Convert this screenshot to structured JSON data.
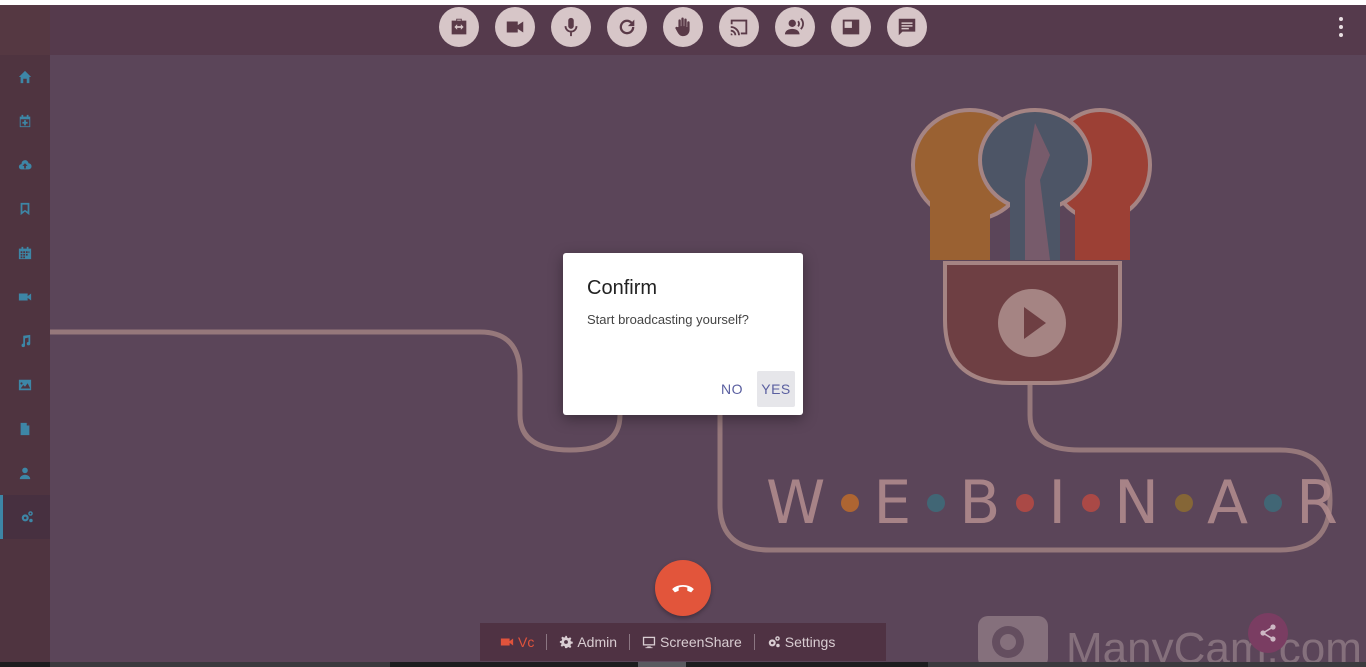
{
  "toolbar": {
    "buttons": [
      {
        "name": "presentation-icon"
      },
      {
        "name": "camera-icon"
      },
      {
        "name": "microphone-icon"
      },
      {
        "name": "refresh-icon"
      },
      {
        "name": "raise-hand-icon"
      },
      {
        "name": "cast-icon"
      },
      {
        "name": "speaker-icon"
      },
      {
        "name": "layout-icon"
      },
      {
        "name": "chat-icon"
      }
    ],
    "menu_icon": "more-vertical-icon"
  },
  "sidebar": {
    "items": [
      {
        "icon": "home-icon"
      },
      {
        "icon": "calendar-plus-icon"
      },
      {
        "icon": "cloud-upload-icon"
      },
      {
        "icon": "bookmark-icon"
      },
      {
        "icon": "calendar-icon"
      },
      {
        "icon": "video-icon"
      },
      {
        "icon": "music-icon"
      },
      {
        "icon": "image-icon"
      },
      {
        "icon": "file-icon"
      },
      {
        "icon": "user-icon"
      },
      {
        "icon": "settings-cogs-icon",
        "active": true
      }
    ]
  },
  "background": {
    "webinar_letters": [
      "W",
      "E",
      "B",
      "I",
      "N",
      "A",
      "R"
    ],
    "dot_colors": [
      "#b7692e",
      "#3f6a79",
      "#b34a45",
      "#b34a45",
      "#8a6a34",
      "#3f6a79"
    ],
    "watermark": "ManyCam.com"
  },
  "bottom_bar": {
    "vc_label": "Vc",
    "admin_label": "Admin",
    "screenshare_label": "ScreenShare",
    "settings_label": "Settings"
  },
  "dialog": {
    "title": "Confirm",
    "message": "Start broadcasting yourself?",
    "no_label": "NO",
    "yes_label": "YES"
  },
  "colors": {
    "accent": "#3d86a6",
    "end_call": "#e2553b",
    "dialog_button_text": "#5a5fa0"
  }
}
